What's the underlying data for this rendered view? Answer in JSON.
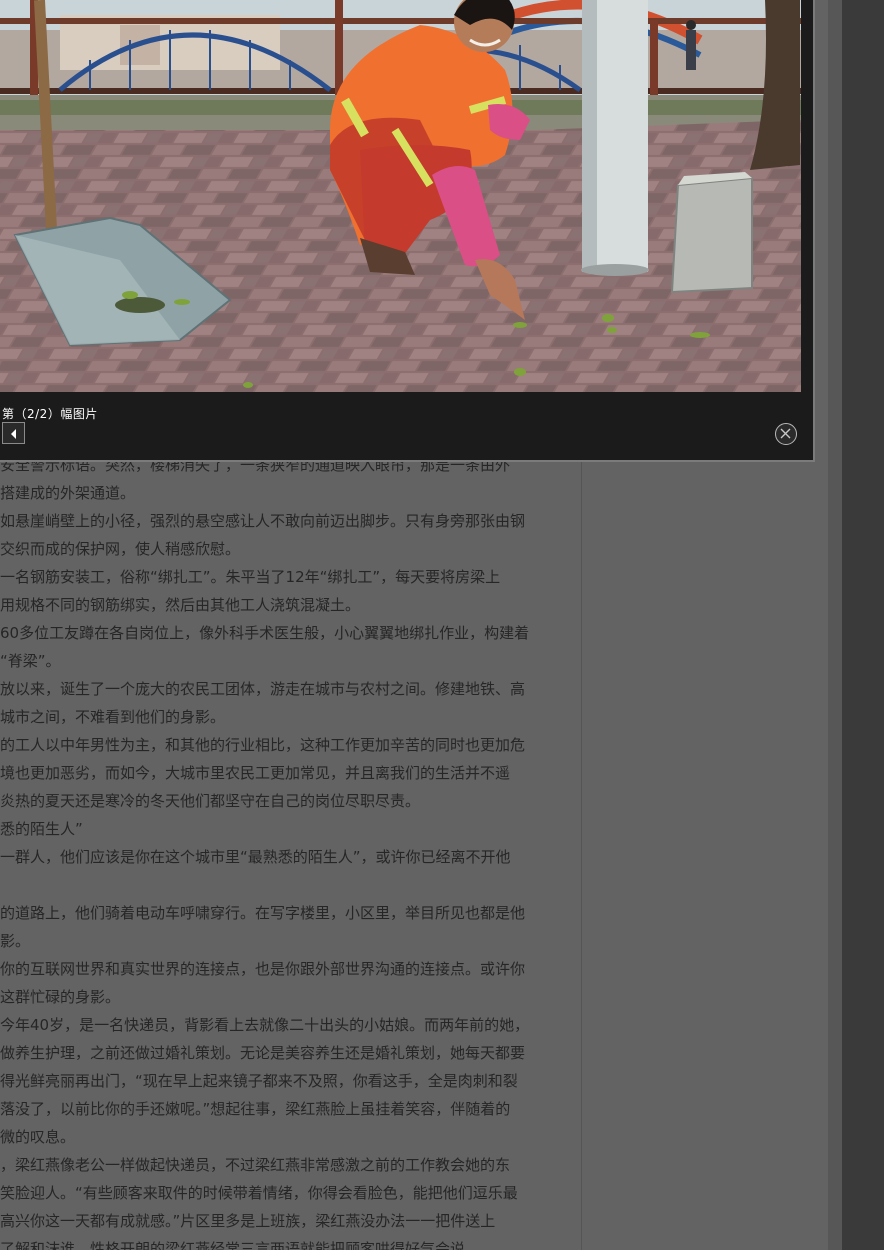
{
  "lightbox": {
    "caption": "第（2/2）幅图片",
    "prev_icon": "triangle-left",
    "close_icon": "circle-x"
  },
  "article": {
    "lines": [
      "安全警示标语。突然，楼梯消失了，一条狭窄的通道映入眼帘，那是一条由外",
      "  搭建成的外架通道。",
      "如悬崖峭壁上的小径，强烈的悬空感让人不敢向前迈出脚步。只有身旁那张由钢",
      "交织而成的保护网，使人稍感欣慰。",
      "一名钢筋安装工，俗称“绑扎工”。朱平当了12年“绑扎工”，每天要将房梁上",
      "用规格不同的钢筋绑实，然后由其他工人浇筑混凝土。",
      "60多位工友蹲在各自岗位上，像外科手术医生般，小心翼翼地绑扎作业，构建着",
      "“脊梁”。",
      "放以来，诞生了一个庞大的农民工团体，游走在城市与农村之间。修建地铁、高",
      "城市之间，不难看到他们的身影。",
      "的工人以中年男性为主，和其他的行业相比，这种工作更加辛苦的同时也更加危",
      "境也更加恶劣，而如今，大城市里农民工更加常见，并且离我们的生活并不遥",
      "炎热的夏天还是寒冷的冬天他们都坚守在自己的岗位尽职尽责。",
      "悉的陌生人”",
      "一群人，他们应该是你在这个城市里“最熟悉的陌生人”，或许你已经离不开他",
      "",
      "的道路上，他们骑着电动车呼啸穿行。在写字楼里，小区里，举目所见也都是他",
      "影。",
      "你的互联网世界和真实世界的连接点，也是你跟外部世界沟通的连接点。或许你",
      "这群忙碌的身影。",
      "今年40岁，是一名快递员，背影看上去就像二十出头的小姑娘。而两年前的她，",
      "做养生护理，之前还做过婚礼策划。无论是美容养生还是婚礼策划，她每天都要",
      "得光鲜亮丽再出门，“现在早上起来镜子都来不及照，你看这手，全是肉刺和裂",
      "落没了，以前比你的手还嫩呢。”想起往事，梁红燕脸上虽挂着笑容，伴随着的",
      "微的叹息。",
      "，梁红燕像老公一样做起快递员，不过梁红燕非常感激之前的工作教会她的东",
      "笑脸迎人。“有些顾客来取件的时候带着情绪，你得会看脸色，能把他们逗乐最",
      "高兴你这一天都有成就感。”片区里多是上班族，梁红燕没办法一一把件送上",
      "了解和沫谁，性格开朗的梁红燕经常三言两语就能把顾客哄得好气会说"
    ]
  },
  "colors": {
    "overlay_bg": "#636363",
    "lightbox_bg": "#1b1b1b",
    "caption_text": "#ffffff",
    "worker_uniform": "#f07030",
    "reflective_stripe": "#d8e060",
    "railing_blue": "#2a5a9a"
  }
}
